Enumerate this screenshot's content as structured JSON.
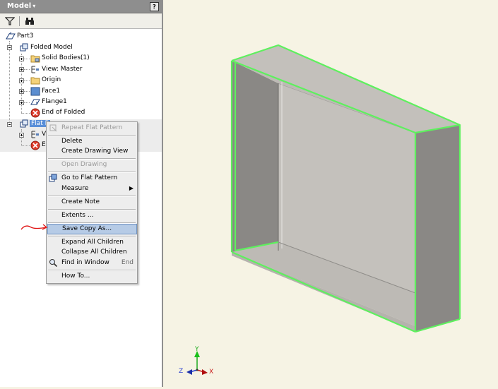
{
  "browser": {
    "title": "Model",
    "title_arrow": "▾",
    "help_label": "?",
    "toolbar": {
      "filter_icon": "filter-icon",
      "find_icon": "binoculars-icon"
    },
    "tree": {
      "root": "Part3",
      "folded_model": "Folded Model",
      "solid_bodies": "Solid Bodies(1)",
      "view_master": "View: Master",
      "origin": "Origin",
      "face1": "Face1",
      "flange1": "Flange1",
      "end_of_folded": "End of Folded",
      "flat_pattern": "Flat Pattern",
      "flat_pattern_visible": "Flat P",
      "child_view_partial": "Vi",
      "child_end_partial": "End"
    }
  },
  "context_menu": {
    "items": [
      {
        "label": "Repeat Flat Pattern",
        "disabled": true
      },
      {
        "label": "Delete"
      },
      {
        "label": "Create Drawing View"
      },
      {
        "label": "Open Drawing",
        "disabled": true
      },
      {
        "label": "Go to Flat Pattern"
      },
      {
        "label": "Measure",
        "submenu": "▶"
      },
      {
        "label": "Create Note"
      },
      {
        "label": "Extents ..."
      },
      {
        "label": "Save Copy As...",
        "highlighted": true
      },
      {
        "label": "Expand All Children"
      },
      {
        "label": "Collapse All Children"
      },
      {
        "label": "Find in Window",
        "shortcut": "End"
      },
      {
        "label": "How To..."
      }
    ]
  },
  "triad": {
    "x_label": "X",
    "y_label": "Y",
    "z_label": "Z"
  },
  "colors": {
    "canvas": "#f6f3e4",
    "edge_highlight": "#5ef05e",
    "face_light": "#c4c1bc",
    "face_dark": "#8a8885",
    "annotation_arrow": "#e01010"
  }
}
